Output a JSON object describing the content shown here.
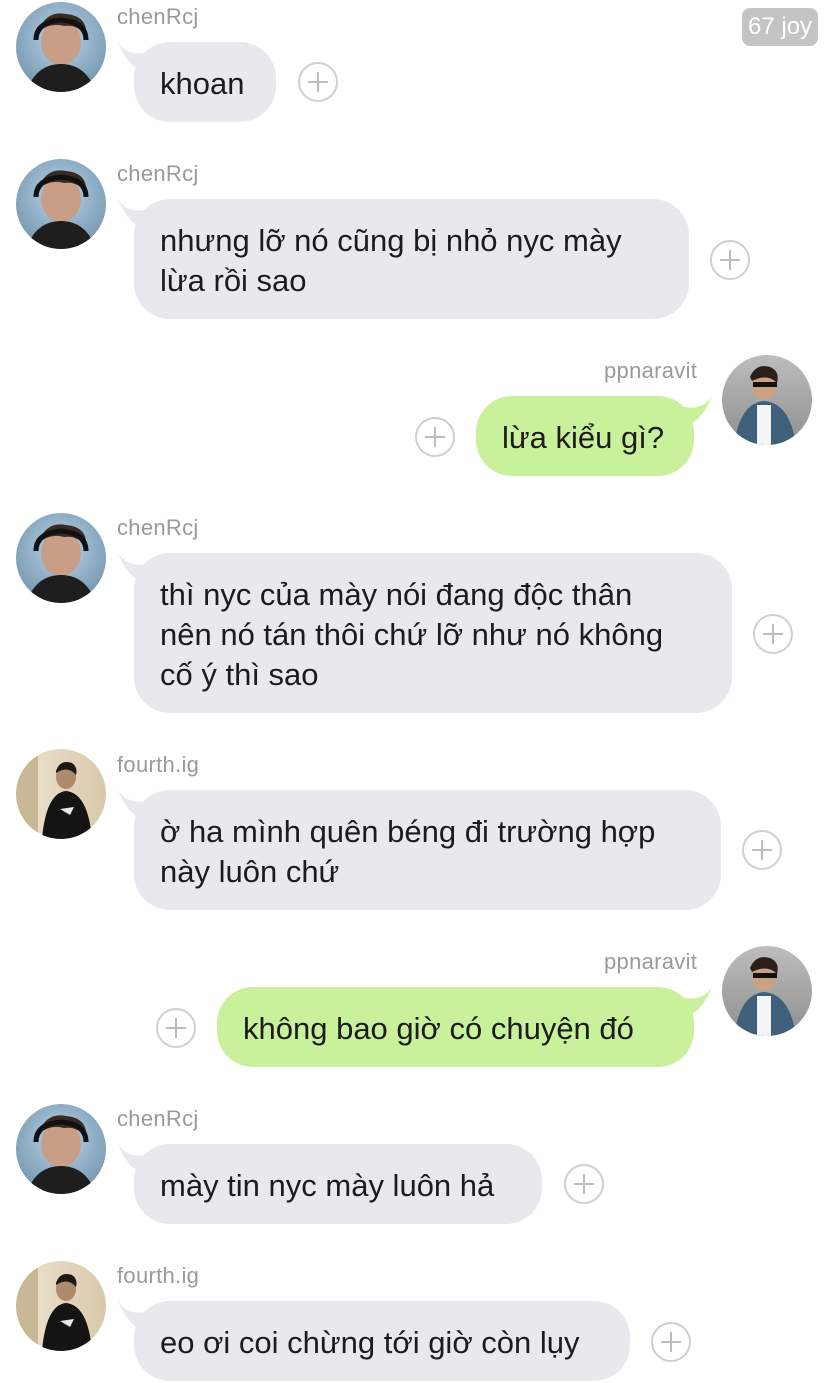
{
  "badge": "67 joy",
  "messages": [
    {
      "sender": "chenRcj",
      "lines": [
        "khoan"
      ]
    },
    {
      "sender": "chenRcj",
      "lines": [
        "nhưng lỡ nó cũng bị nhỏ nyc mày",
        "lừa rồi sao"
      ]
    },
    {
      "sender": "ppnaravit",
      "lines": [
        "lừa kiểu gì?"
      ]
    },
    {
      "sender": "chenRcj",
      "lines": [
        "thì nyc của mày nói đang độc thân",
        "nên nó tán thôi chứ lỡ như nó không",
        "cố ý thì sao"
      ]
    },
    {
      "sender": "fourth.ig",
      "lines": [
        "ờ ha mình quên béng đi trường hợp",
        "này luôn chứ"
      ]
    },
    {
      "sender": "ppnaravit",
      "lines": [
        "không bao giờ có chuyện đó"
      ]
    },
    {
      "sender": "chenRcj",
      "lines": [
        "mày tin nyc mày luôn hả"
      ]
    },
    {
      "sender": "fourth.ig",
      "lines": [
        "eo ơi coi chừng tới giờ còn lụy"
      ]
    }
  ],
  "colors": {
    "incoming_bubble": "#e7e9ed",
    "outgoing_bubble": "#c9f09a",
    "sender_name": "#9a9a9a"
  }
}
